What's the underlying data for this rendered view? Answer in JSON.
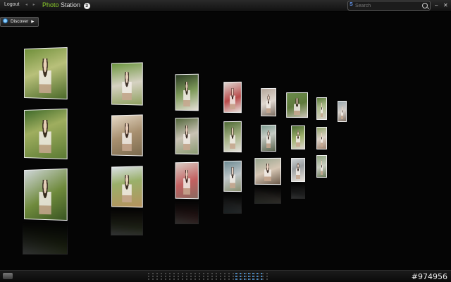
{
  "topbar": {
    "logout_label": "Logout",
    "nav_arrows": "◂ ▸",
    "title_part1": "Photo",
    "title_part2": "Station",
    "version": "3",
    "search_placeholder": "Search",
    "search_brand": "S",
    "minimize": "–",
    "close": "✕"
  },
  "discover": {
    "label": "Discover",
    "arrow": "▶"
  },
  "photos": [
    {
      "id": "p1",
      "bg": "linear-gradient(160deg,#6f8f3a,#b8c07a 45%,#4c6a2a)"
    },
    {
      "id": "p2",
      "bg": "linear-gradient(160deg,#3f6a2a,#9fae5f 40%,#5b7a33)"
    },
    {
      "id": "p3",
      "bg": "linear-gradient(150deg,#cfd6d8,#6f8a3c 55%,#395522)"
    },
    {
      "id": "p4",
      "bg": "linear-gradient(170deg,#6d9640,#d6d2c2 50%,#8fa060)"
    },
    {
      "id": "p5",
      "bg": "linear-gradient(160deg,#e5d8c5,#a89070 50%,#7b6a4e)"
    },
    {
      "id": "p6",
      "bg": "linear-gradient(170deg,#d9dfe4,#9ab06a 40%,#b5925e)"
    },
    {
      "id": "p7",
      "bg": "linear-gradient(160deg,#2a3a22,#7e9a5a 50%,#e6e0d6)"
    },
    {
      "id": "p8",
      "bg": "linear-gradient(160deg,#52663a,#c9c2b4 50%,#8a9a72)"
    },
    {
      "id": "p9",
      "bg": "linear-gradient(160deg,#d8ccc4,#c26060 55%,#8a6a60)"
    },
    {
      "id": "p10",
      "bg": "linear-gradient(160deg,#ddd6d0,#b94b4b 55%,#e8e2dc)"
    },
    {
      "id": "p11",
      "bg": "linear-gradient(160deg,#4e6a34,#a4b084 50%,#e5e1db)"
    },
    {
      "id": "p12",
      "bg": "linear-gradient(160deg,#6c8a92,#bfc6c8 50%,#8a9070)"
    },
    {
      "id": "p13",
      "bg": "linear-gradient(160deg,#b5a79b,#e0d8d0 50%,#7c6e62)"
    },
    {
      "id": "p14",
      "bg": "linear-gradient(160deg,#7a9a8e,#c6cbc4 40%,#5c6650)"
    },
    {
      "id": "p15",
      "bg": "linear-gradient(160deg,#96a48e,#d6c6b4 50%,#6b5a4a)"
    },
    {
      "id": "p16",
      "bg": "linear-gradient(160deg,#6a8a4a,#5f7a3c 50%,#c9c3b5)"
    },
    {
      "id": "p17",
      "bg": "linear-gradient(160deg,#4a6a32,#9eb06c 50%,#dcd6cf)"
    },
    {
      "id": "p18",
      "bg": "linear-gradient(160deg,#cfd4d6,#9a9ea0 40%,#e8e2da)"
    },
    {
      "id": "p19",
      "bg": "linear-gradient(160deg,#5b7a3a,#a8b888 40%,#d8d0c8)"
    },
    {
      "id": "p20",
      "bg": "linear-gradient(160deg,#8fa26a,#dcd2c8 50%,#a08470)"
    },
    {
      "id": "p21",
      "bg": "linear-gradient(160deg,#8aa07a,#c8ccc0 50%,#6a7a5a)"
    },
    {
      "id": "p22",
      "bg": "linear-gradient(160deg,#9aa8ae,#d6d0ca 50%,#7e7064)"
    },
    {
      "id": "p23",
      "bg": "linear-gradient(160deg,#c8c0b8,#e6dcd2 50%,#a09080)"
    },
    {
      "id": "p24",
      "bg": "linear-gradient(160deg,#7a8a90,#b8c0c0 50%,#566048)"
    },
    {
      "id": "p25",
      "bg": "linear-gradient(160deg,#6c9a4e,#c2ccb0 50%,#e2ddd6)"
    }
  ],
  "statusbar": {
    "watermark": "#974956"
  }
}
